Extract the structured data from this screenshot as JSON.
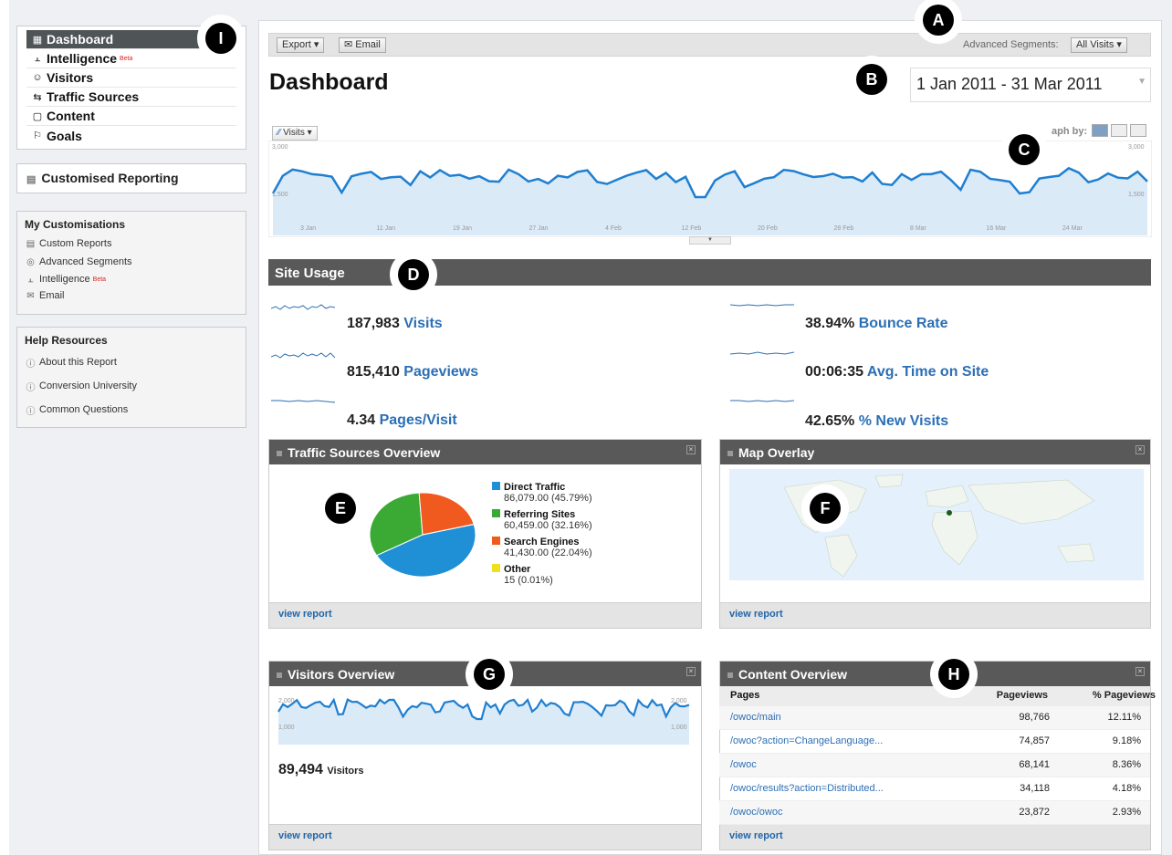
{
  "nav": {
    "items": [
      {
        "label": "Dashboard",
        "icon": "grid-icon"
      },
      {
        "label": "Intelligence",
        "icon": "chart-icon",
        "badge": "Beta"
      },
      {
        "label": "Visitors",
        "icon": "person-icon"
      },
      {
        "label": "Traffic Sources",
        "icon": "traffic-icon"
      },
      {
        "label": "Content",
        "icon": "page-icon"
      },
      {
        "label": "Goals",
        "icon": "flag-icon"
      }
    ],
    "custom_reporting": "Customised Reporting"
  },
  "my_customisations": {
    "title": "My Customisations",
    "items": [
      "Custom Reports",
      "Advanced Segments",
      "Intelligence",
      "Email"
    ],
    "beta": "Beta"
  },
  "help": {
    "title": "Help Resources",
    "items": [
      "About this Report",
      "Conversion University",
      "Common Questions"
    ]
  },
  "toolbar": {
    "export": "Export ▾",
    "email": "Email",
    "segments_label": "Advanced Segments:",
    "segments_value": "All Visits ▾"
  },
  "page_title": "Dashboard",
  "date_range": "1 Jan 2011 - 31 Mar 2011",
  "graph": {
    "selector": "Visits ▾",
    "graph_by": "aph by:",
    "y_top": "3,000",
    "y_mid": "1,500",
    "x_labels": [
      "3 Jan",
      "11 Jan",
      "19 Jan",
      "27 Jan",
      "4 Feb",
      "12 Feb",
      "20 Feb",
      "28 Feb",
      "8 Mar",
      "16 Mar",
      "24 Mar"
    ]
  },
  "site_usage": {
    "title": "Site Usage",
    "stats": [
      {
        "value": "187,983",
        "label": "Visits"
      },
      {
        "value": "815,410",
        "label": "Pageviews"
      },
      {
        "value": "4.34",
        "label": "Pages/Visit"
      },
      {
        "value": "38.94%",
        "label": "Bounce Rate"
      },
      {
        "value": "00:06:35",
        "label": "Avg. Time on Site"
      },
      {
        "value": "42.65%",
        "label": "% New Visits"
      }
    ]
  },
  "traffic_sources": {
    "title": "Traffic Sources Overview",
    "legend": [
      {
        "label": "Direct Traffic",
        "detail": "86,079.00 (45.79%)",
        "color": "#1f8fd6",
        "pct": 45.79
      },
      {
        "label": "Referring Sites",
        "detail": "60,459.00 (32.16%)",
        "color": "#3aaa35",
        "pct": 32.16
      },
      {
        "label": "Search Engines",
        "detail": "41,430.00 (22.04%)",
        "color": "#f05a1e",
        "pct": 22.04
      },
      {
        "label": "Other",
        "detail": "15 (0.01%)",
        "color": "#f0e020",
        "pct": 0.01
      }
    ],
    "view_report": "view report"
  },
  "map_overlay": {
    "title": "Map Overlay",
    "view_report": "view report"
  },
  "visitors_overview": {
    "title": "Visitors Overview",
    "y_top": "2,000",
    "y_mid": "1,000",
    "count": "89,494",
    "count_label": "Visitors",
    "view_report": "view report"
  },
  "content_overview": {
    "title": "Content Overview",
    "headers": [
      "Pages",
      "Pageviews",
      "% Pageviews"
    ],
    "rows": [
      [
        "/owoc/main",
        "98,766",
        "12.11%"
      ],
      [
        "/owoc?action=ChangeLanguage...",
        "74,857",
        "9.18%"
      ],
      [
        "/owoc",
        "68,141",
        "8.36%"
      ],
      [
        "/owoc/results?action=Distributed...",
        "34,118",
        "4.18%"
      ],
      [
        "/owoc/owoc",
        "23,872",
        "2.93%"
      ]
    ],
    "view_report": "view report"
  },
  "markers": [
    "A",
    "B",
    "C",
    "D",
    "E",
    "F",
    "G",
    "H",
    "I"
  ],
  "colors": {
    "accent": "#2b6fb5",
    "line": "#1f7fd0",
    "fill": "#dbeaf7",
    "header": "#595959"
  }
}
